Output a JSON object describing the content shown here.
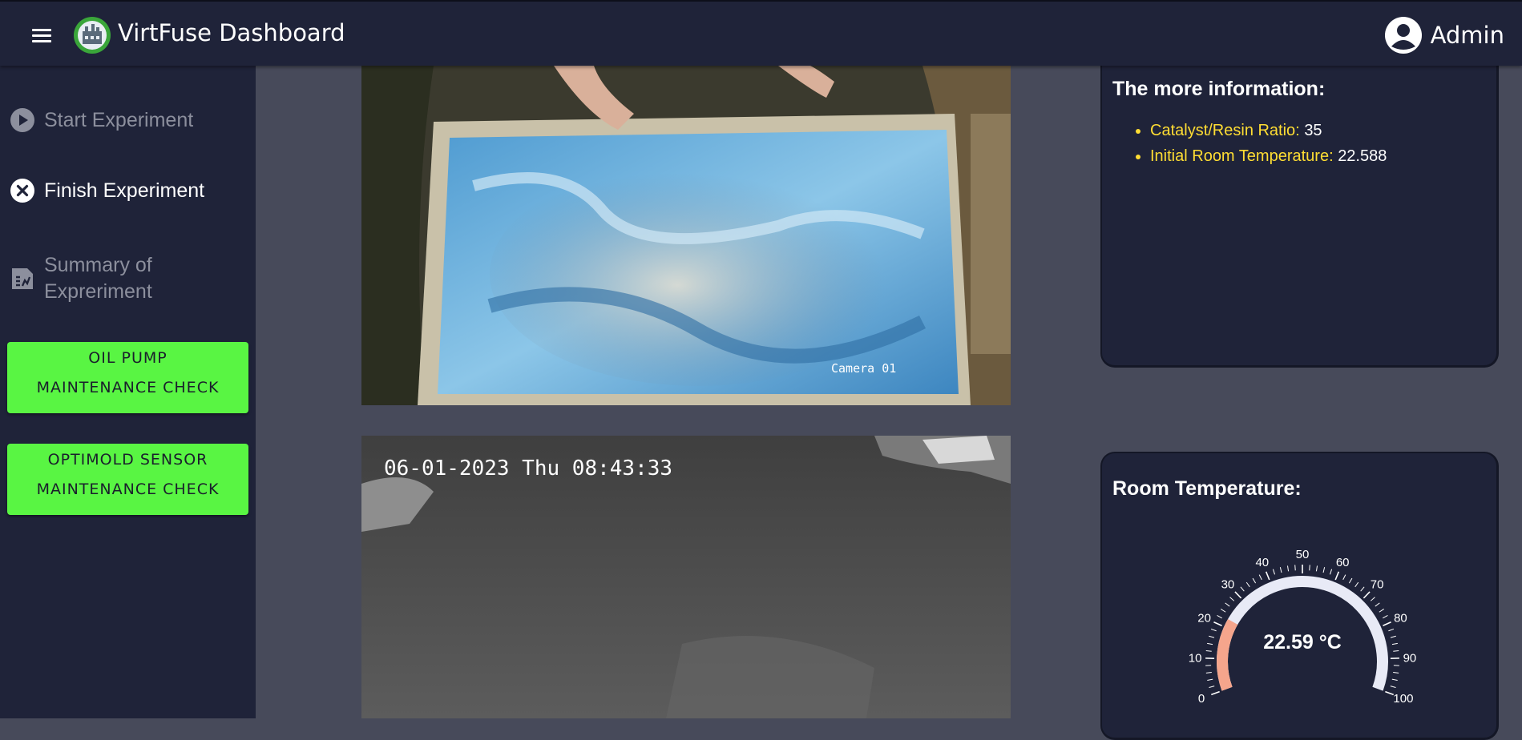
{
  "header": {
    "title": "VirtFuse Dashboard",
    "user": "Admin"
  },
  "sidebar": {
    "items": [
      {
        "label": "Start Experiment",
        "icon": "play-circle-icon",
        "state": "disabled"
      },
      {
        "label": "Finish Experiment",
        "icon": "close-circle-icon",
        "state": "active"
      },
      {
        "label_line1": "Summary of",
        "label_line2": "Expreriment",
        "icon": "summary-document-icon",
        "state": "disabled"
      }
    ],
    "buttons": [
      {
        "line1": "OIL PUMP",
        "line2": "MAINTENANCE CHECK"
      },
      {
        "line1": "OPTIMOLD SENSOR",
        "line2": "MAINTENANCE CHECK"
      }
    ]
  },
  "cameras": [
    {
      "label": "Camera 01"
    },
    {
      "timestamp": "06-01-2023 Thu 08:43:33"
    }
  ],
  "info_panel": {
    "title": "The more information:",
    "items": [
      {
        "label": "Catalyst/Resin Ratio:",
        "value": "35"
      },
      {
        "label": "Initial Room Temperature:",
        "value": "22.588"
      }
    ]
  },
  "temp_panel": {
    "title": "Room Temperature:",
    "value_text": "22.59 °C",
    "value": 22.59,
    "min": 0,
    "max": 100,
    "tick_labels": [
      "0",
      "10",
      "20",
      "30",
      "40",
      "50",
      "60",
      "70",
      "80",
      "90",
      "100"
    ]
  },
  "colors": {
    "bar_bg": "#1f2339",
    "accent_green": "#59f543",
    "info_label": "#ffdd33",
    "gauge_fill": "#f5a58c",
    "gauge_track": "#e8eaf6"
  }
}
